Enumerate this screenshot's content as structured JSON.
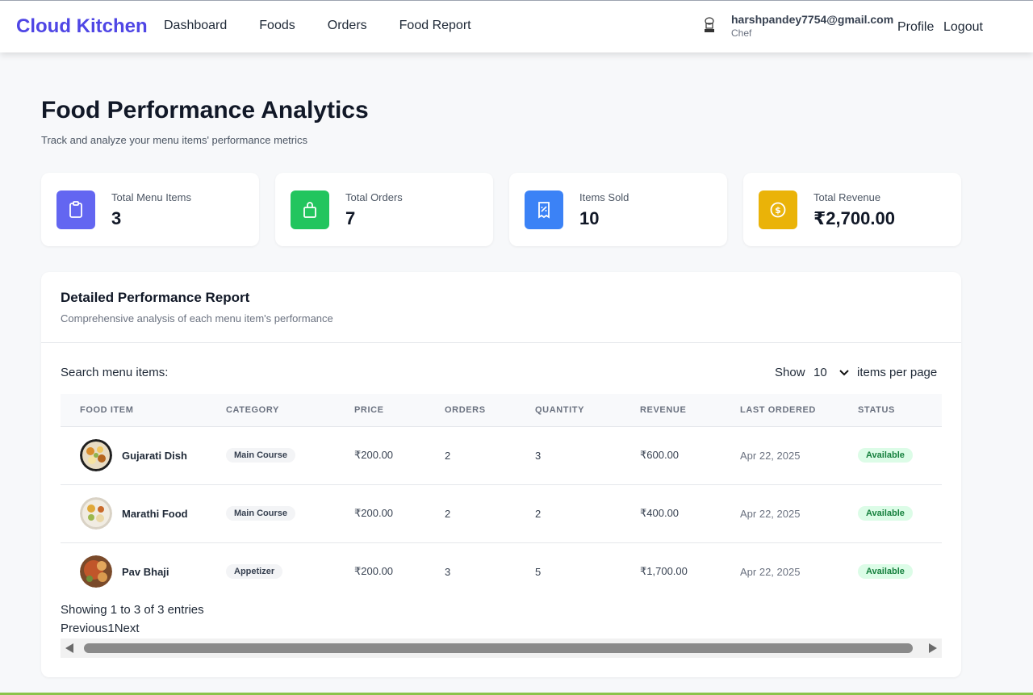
{
  "nav": {
    "brand": "Cloud Kitchen",
    "links": [
      "Dashboard",
      "Foods",
      "Orders",
      "Food Report"
    ],
    "user_email": "harshpandey7754@gmail.com",
    "user_role": "Chef",
    "profile": "Profile",
    "logout": "Logout"
  },
  "header": {
    "title": "Food Performance Analytics",
    "subtitle": "Track and analyze your menu items' performance metrics"
  },
  "stats": [
    {
      "label": "Total Menu Items",
      "value": "3",
      "color": "#6366f1",
      "icon": "clipboard-icon"
    },
    {
      "label": "Total Orders",
      "value": "7",
      "color": "#22c55e",
      "icon": "shopping-bag-icon"
    },
    {
      "label": "Items Sold",
      "value": "10",
      "color": "#3b82f6",
      "icon": "receipt-icon"
    },
    {
      "label": "Total Revenue",
      "value": "₹2,700.00",
      "color": "#eab308",
      "icon": "dollar-coin-icon"
    }
  ],
  "report": {
    "title": "Detailed Performance Report",
    "subtitle": "Comprehensive analysis of each menu item's performance",
    "search_label": "Search menu items:",
    "show_label": "Show",
    "page_size": "10",
    "per_page_label": "items per page",
    "columns": [
      "FOOD ITEM",
      "CATEGORY",
      "PRICE",
      "ORDERS",
      "QUANTITY",
      "REVENUE",
      "LAST ORDERED",
      "STATUS"
    ],
    "rows": [
      {
        "name": "Gujarati Dish",
        "category": "Main Course",
        "price": "₹200.00",
        "orders": "2",
        "quantity": "3",
        "revenue": "₹600.00",
        "last_ordered": "Apr 22, 2025",
        "status": "Available"
      },
      {
        "name": "Marathi Food",
        "category": "Main Course",
        "price": "₹200.00",
        "orders": "2",
        "quantity": "2",
        "revenue": "₹400.00",
        "last_ordered": "Apr 22, 2025",
        "status": "Available"
      },
      {
        "name": "Pav Bhaji",
        "category": "Appetizer",
        "price": "₹200.00",
        "orders": "3",
        "quantity": "5",
        "revenue": "₹1,700.00",
        "last_ordered": "Apr 22, 2025",
        "status": "Available"
      }
    ],
    "showing": "Showing 1 to 3 of 3 entries",
    "pager": {
      "prev": "Previous",
      "page": "1",
      "next": "Next"
    }
  }
}
